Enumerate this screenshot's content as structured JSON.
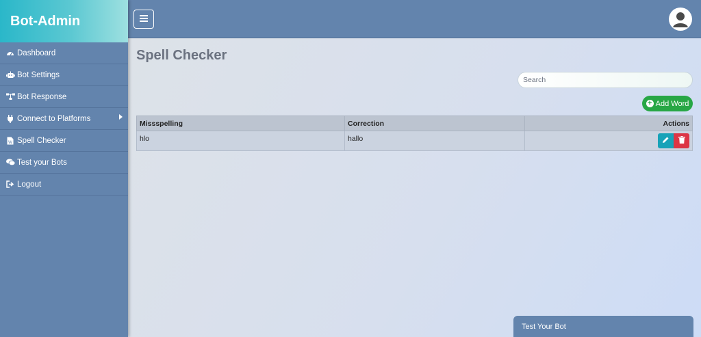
{
  "brand": {
    "title": "Bot-Admin"
  },
  "sidebar": {
    "items": [
      {
        "label": "Dashboard",
        "icon": "dashboard-icon"
      },
      {
        "label": "Bot Settings",
        "icon": "robot-icon"
      },
      {
        "label": "Bot Response",
        "icon": "sitemap-icon"
      },
      {
        "label": "Connect to Platforms",
        "icon": "plug-icon"
      },
      {
        "label": "Spell Checker",
        "icon": "document-icon"
      },
      {
        "label": "Test your Bots",
        "icon": "chat-icon"
      },
      {
        "label": "Logout",
        "icon": "logout-icon"
      }
    ]
  },
  "header": {
    "menu_icon": "hamburger-icon",
    "avatar_icon": "user-icon"
  },
  "main": {
    "title": "Spell Checker",
    "search": {
      "placeholder": "Search",
      "value": ""
    },
    "add_button": "Add Word",
    "table": {
      "headers": [
        "Missspelling",
        "Correction",
        "Actions"
      ],
      "rows": [
        {
          "misspelling": "hlo",
          "correction": "hallo"
        }
      ]
    }
  },
  "widget": {
    "label": "Test Your Bot"
  },
  "colors": {
    "sidebar": "#6384ad",
    "brand_gradient_start": "#2ab7c9",
    "success": "#28a745",
    "info": "#17a2b8",
    "danger": "#dc3545"
  }
}
